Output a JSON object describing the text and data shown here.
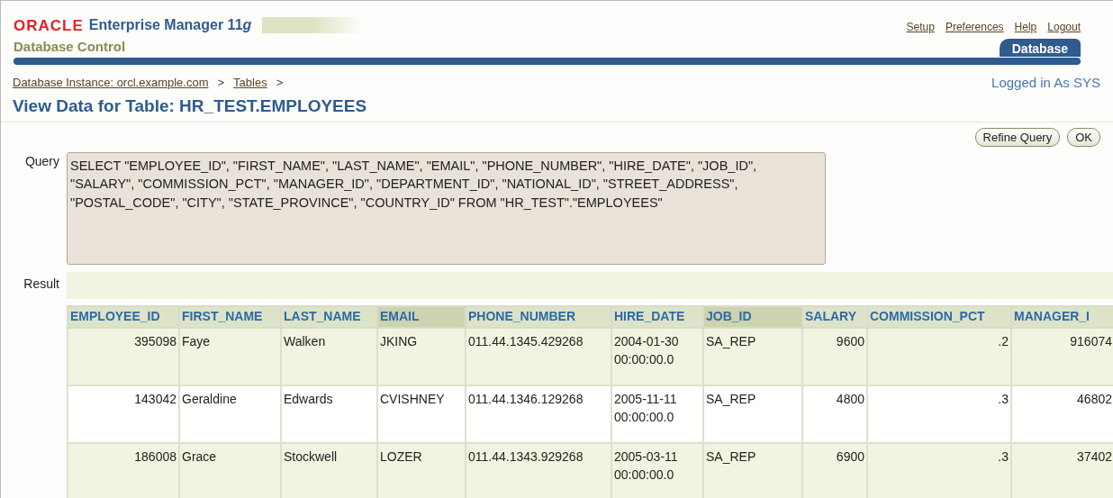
{
  "header": {
    "brand": "ORACLE",
    "product": "Enterprise Manager 11",
    "product_suffix": "g",
    "subtitle": "Database Control",
    "global_links": [
      "Setup",
      "Preferences",
      "Help",
      "Logout"
    ],
    "tabs": [
      {
        "label": "Database",
        "selected": true
      }
    ]
  },
  "breadcrumbs": [
    {
      "label": "Database Instance: orcl.example.com",
      "separator": ">"
    },
    {
      "label": "Tables",
      "separator": ">"
    }
  ],
  "login_status": "Logged in As SYS",
  "page_title": "View Data for Table: HR_TEST.EMPLOYEES",
  "buttons": [
    "Refine Query",
    "OK"
  ],
  "query": {
    "label": "Query",
    "value": "SELECT \"EMPLOYEE_ID\", \"FIRST_NAME\", \"LAST_NAME\", \"EMAIL\", \"PHONE_NUMBER\", \"HIRE_DATE\", \"JOB_ID\", \"SALARY\", \"COMMISSION_PCT\", \"MANAGER_ID\", \"DEPARTMENT_ID\", \"NATIONAL_ID\", \"STREET_ADDRESS\", \"POSTAL_CODE\", \"CITY\", \"STATE_PROVINCE\", \"COUNTRY_ID\" FROM \"HR_TEST\".\"EMPLOYEES\""
  },
  "result": {
    "label": "Result",
    "table": {
      "columns": [
        {
          "label": "EMPLOYEE_ID",
          "kind": "number",
          "highlighted": false
        },
        {
          "label": "FIRST_NAME",
          "kind": "text",
          "highlighted": false
        },
        {
          "label": "LAST_NAME",
          "kind": "text",
          "highlighted": false
        },
        {
          "label": "EMAIL",
          "kind": "text",
          "highlighted": true
        },
        {
          "label": "PHONE_NUMBER",
          "kind": "text",
          "highlighted": false
        },
        {
          "label": "HIRE_DATE",
          "kind": "text",
          "highlighted": false
        },
        {
          "label": "JOB_ID",
          "kind": "text",
          "highlighted": true
        },
        {
          "label": "SALARY",
          "kind": "number",
          "highlighted": false
        },
        {
          "label": "COMMISSION_PCT",
          "kind": "number",
          "highlighted": false
        },
        {
          "label": "MANAGER_I",
          "kind": "number",
          "highlighted": false
        }
      ],
      "rows": [
        {
          "cells": [
            "395098",
            "Faye",
            "Walken",
            "JKING",
            "011.44.1345.429268",
            "2004-01-30 00:00:00.0",
            "SA_REP",
            "9600",
            ".2",
            "916074"
          ]
        },
        {
          "cells": [
            "143042",
            "Geraldine",
            "Edwards",
            "CVISHNEY",
            "011.44.1346.129268",
            "2005-11-11 00:00:00.0",
            "SA_REP",
            "4800",
            ".3",
            "46802"
          ]
        },
        {
          "cells": [
            "186008",
            "Grace",
            "Stockwell",
            "LOZER",
            "011.44.1343.929268",
            "2005-03-11 00:00:00.0",
            "SA_REP",
            "6900",
            ".3",
            "37402"
          ]
        }
      ]
    }
  }
}
